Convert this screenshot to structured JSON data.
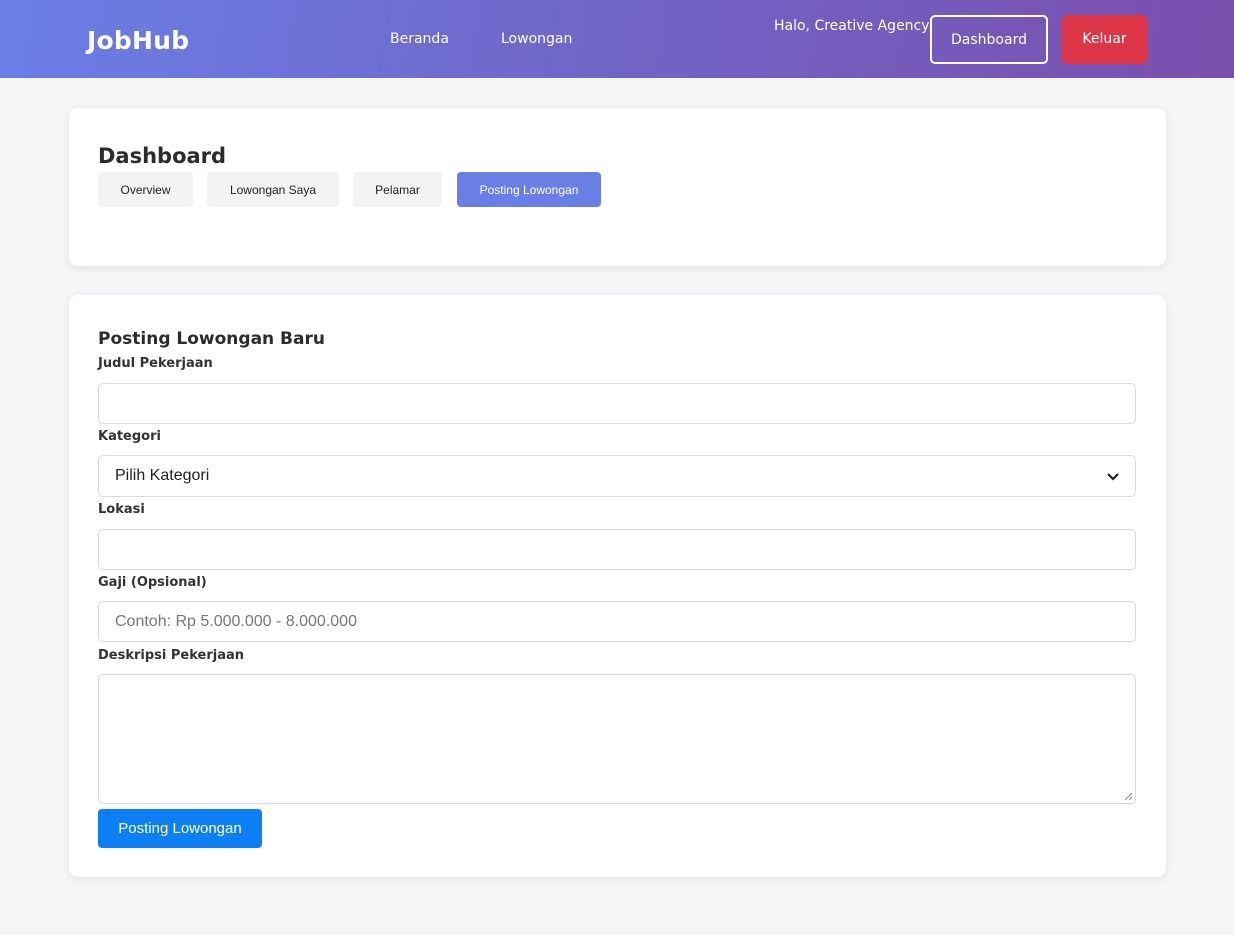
{
  "header": {
    "brand": "JobHub",
    "nav": {
      "home": "Beranda",
      "jobs": "Lowongan"
    },
    "greeting": "Halo, Creative Agency",
    "dashboard_label": "Dashboard",
    "logout_label": "Keluar"
  },
  "dashboard": {
    "title": "Dashboard",
    "tabs": [
      "Overview",
      "Lowongan Saya",
      "Pelamar",
      "Posting Lowongan"
    ],
    "active_tab": "Posting Lowongan"
  },
  "form": {
    "title": "Posting Lowongan Baru",
    "job_title": {
      "label": "Judul Pekerjaan",
      "value": ""
    },
    "category": {
      "label": "Kategori",
      "selected": "Pilih Kategori"
    },
    "location": {
      "label": "Lokasi",
      "value": ""
    },
    "salary": {
      "label": "Gaji (Opsional)",
      "placeholder": "Contoh: Rp 5.000.000 - 8.000.000"
    },
    "description": {
      "label": "Deskripsi Pekerjaan",
      "value": ""
    },
    "submit_label": "Posting Lowongan"
  },
  "colors": {
    "header_gradient_start": "#6a7fe6",
    "header_gradient_end": "#7a4fae",
    "active_tab": "#6a7fe6",
    "logout": "#dc3545",
    "submit": "#0d7ff5"
  },
  "icons": {
    "select_chevron": "chevron-down-icon"
  }
}
